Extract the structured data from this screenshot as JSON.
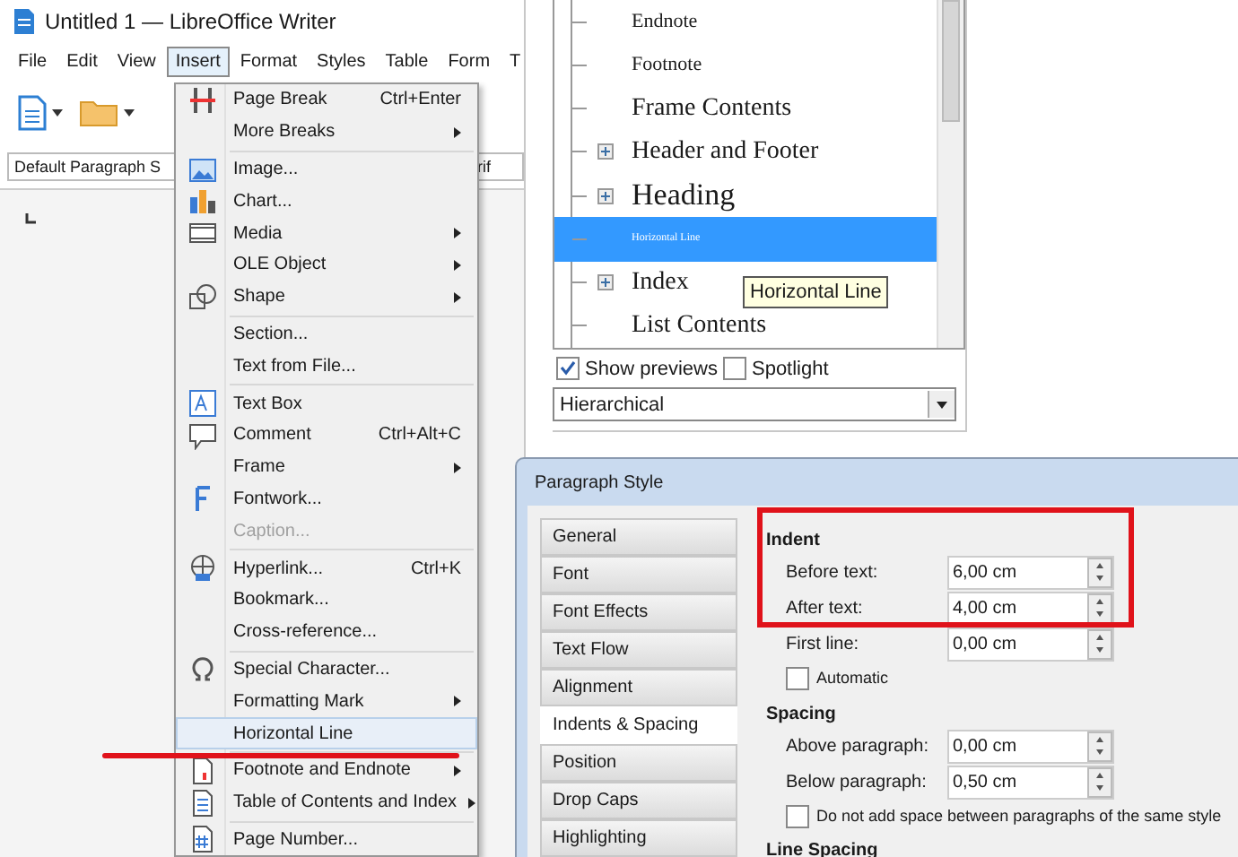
{
  "writer": {
    "title": "Untitled 1 — LibreOffice Writer",
    "menu": [
      {
        "label": "File",
        "selected": false
      },
      {
        "label": "Edit",
        "selected": false
      },
      {
        "label": "View",
        "selected": false
      },
      {
        "label": "Insert",
        "selected": true
      },
      {
        "label": "Format",
        "selected": false
      },
      {
        "label": "Styles",
        "selected": false
      },
      {
        "label": "Table",
        "selected": false
      },
      {
        "label": "Form",
        "selected": false
      },
      {
        "label": "T",
        "selected": false
      }
    ],
    "paragraph_style": "Default Paragraph S",
    "font_name": "rif"
  },
  "insert_menu": {
    "groups": [
      [
        {
          "label": "Page Break",
          "shortcut": "Ctrl+Enter",
          "submenu": false,
          "disabled": false,
          "selected": false
        },
        {
          "label": "More Breaks",
          "submenu": true,
          "disabled": false,
          "selected": false
        }
      ],
      [
        {
          "label": "Image...",
          "submenu": false,
          "disabled": false,
          "selected": false
        },
        {
          "label": "Chart...",
          "submenu": false,
          "disabled": false,
          "selected": false
        },
        {
          "label": "Media",
          "submenu": true,
          "disabled": false,
          "selected": false
        },
        {
          "label": "OLE Object",
          "submenu": true,
          "disabled": false,
          "selected": false
        },
        {
          "label": "Shape",
          "submenu": true,
          "disabled": false,
          "selected": false
        }
      ],
      [
        {
          "label": "Section...",
          "submenu": false,
          "disabled": false,
          "selected": false
        },
        {
          "label": "Text from File...",
          "submenu": false,
          "disabled": false,
          "selected": false
        }
      ],
      [
        {
          "label": "Text Box",
          "submenu": false,
          "disabled": false,
          "selected": false
        },
        {
          "label": "Comment",
          "shortcut": "Ctrl+Alt+C",
          "submenu": false,
          "disabled": false,
          "selected": false
        },
        {
          "label": "Frame",
          "submenu": true,
          "disabled": false,
          "selected": false
        },
        {
          "label": "Fontwork...",
          "submenu": false,
          "disabled": false,
          "selected": false
        },
        {
          "label": "Caption...",
          "submenu": false,
          "disabled": true,
          "selected": false
        }
      ],
      [
        {
          "label": "Hyperlink...",
          "shortcut": "Ctrl+K",
          "submenu": false,
          "disabled": false,
          "selected": false
        },
        {
          "label": "Bookmark...",
          "submenu": false,
          "disabled": false,
          "selected": false
        },
        {
          "label": "Cross-reference...",
          "submenu": false,
          "disabled": false,
          "selected": false
        }
      ],
      [
        {
          "label": "Special Character...",
          "submenu": false,
          "disabled": false,
          "selected": false
        },
        {
          "label": "Formatting Mark",
          "submenu": true,
          "disabled": false,
          "selected": false
        },
        {
          "label": "Horizontal Line",
          "submenu": false,
          "disabled": false,
          "selected": true
        }
      ],
      [
        {
          "label": "Footnote and Endnote",
          "submenu": true,
          "disabled": false,
          "selected": false
        },
        {
          "label": "Table of Contents and Index",
          "submenu": true,
          "disabled": false,
          "selected": false
        }
      ],
      [
        {
          "label": "Page Number...",
          "submenu": false,
          "disabled": false,
          "selected": false
        }
      ]
    ]
  },
  "styles_panel": {
    "items": [
      {
        "label": "Endnote",
        "kind": "small",
        "has_children": false,
        "selected": false
      },
      {
        "label": "Footnote",
        "kind": "small",
        "has_children": false,
        "selected": false
      },
      {
        "label": "Frame Contents",
        "kind": "medium",
        "has_children": false,
        "selected": false
      },
      {
        "label": "Header and Footer",
        "kind": "medium",
        "has_children": true,
        "selected": false
      },
      {
        "label": "Heading",
        "kind": "large",
        "has_children": true,
        "selected": false
      },
      {
        "label": "Horizontal Line",
        "kind": "tiny",
        "has_children": false,
        "selected": true
      },
      {
        "label": "Index",
        "kind": "medium",
        "has_children": true,
        "selected": false
      },
      {
        "label": "List Contents",
        "kind": "medium",
        "has_children": false,
        "selected": false
      }
    ],
    "tooltip": "Horizontal Line",
    "show_previews": {
      "label": "Show previews",
      "checked": true
    },
    "spotlight": {
      "label": "Spotlight",
      "checked": false
    },
    "filter": "Hierarchical"
  },
  "dialog": {
    "title": "Paragraph Style",
    "tabs": [
      {
        "label": "General",
        "selected": false
      },
      {
        "label": "Font",
        "selected": false
      },
      {
        "label": "Font Effects",
        "selected": false
      },
      {
        "label": "Text Flow",
        "selected": false
      },
      {
        "label": "Alignment",
        "selected": false
      },
      {
        "label": "Indents & Spacing",
        "selected": true
      },
      {
        "label": "Position",
        "selected": false
      },
      {
        "label": "Drop Caps",
        "selected": false
      },
      {
        "label": "Highlighting",
        "selected": false
      }
    ],
    "sections": [
      {
        "heading": "Indent",
        "fields": [
          {
            "label": "Before text:",
            "value": "6,00 cm"
          },
          {
            "label": "After text:",
            "value": "4,00 cm"
          },
          {
            "label": "First line:",
            "value": "0,00 cm"
          }
        ],
        "checkbox": {
          "label": "Automatic",
          "checked": false
        }
      },
      {
        "heading": "Spacing",
        "fields": [
          {
            "label": "Above paragraph:",
            "value": "0,00 cm"
          },
          {
            "label": "Below paragraph:",
            "value": "0,50 cm"
          }
        ],
        "checkbox": {
          "label": "Do not add space between paragraphs of the same style",
          "checked": false
        }
      },
      {
        "heading": "Line Spacing"
      }
    ]
  }
}
